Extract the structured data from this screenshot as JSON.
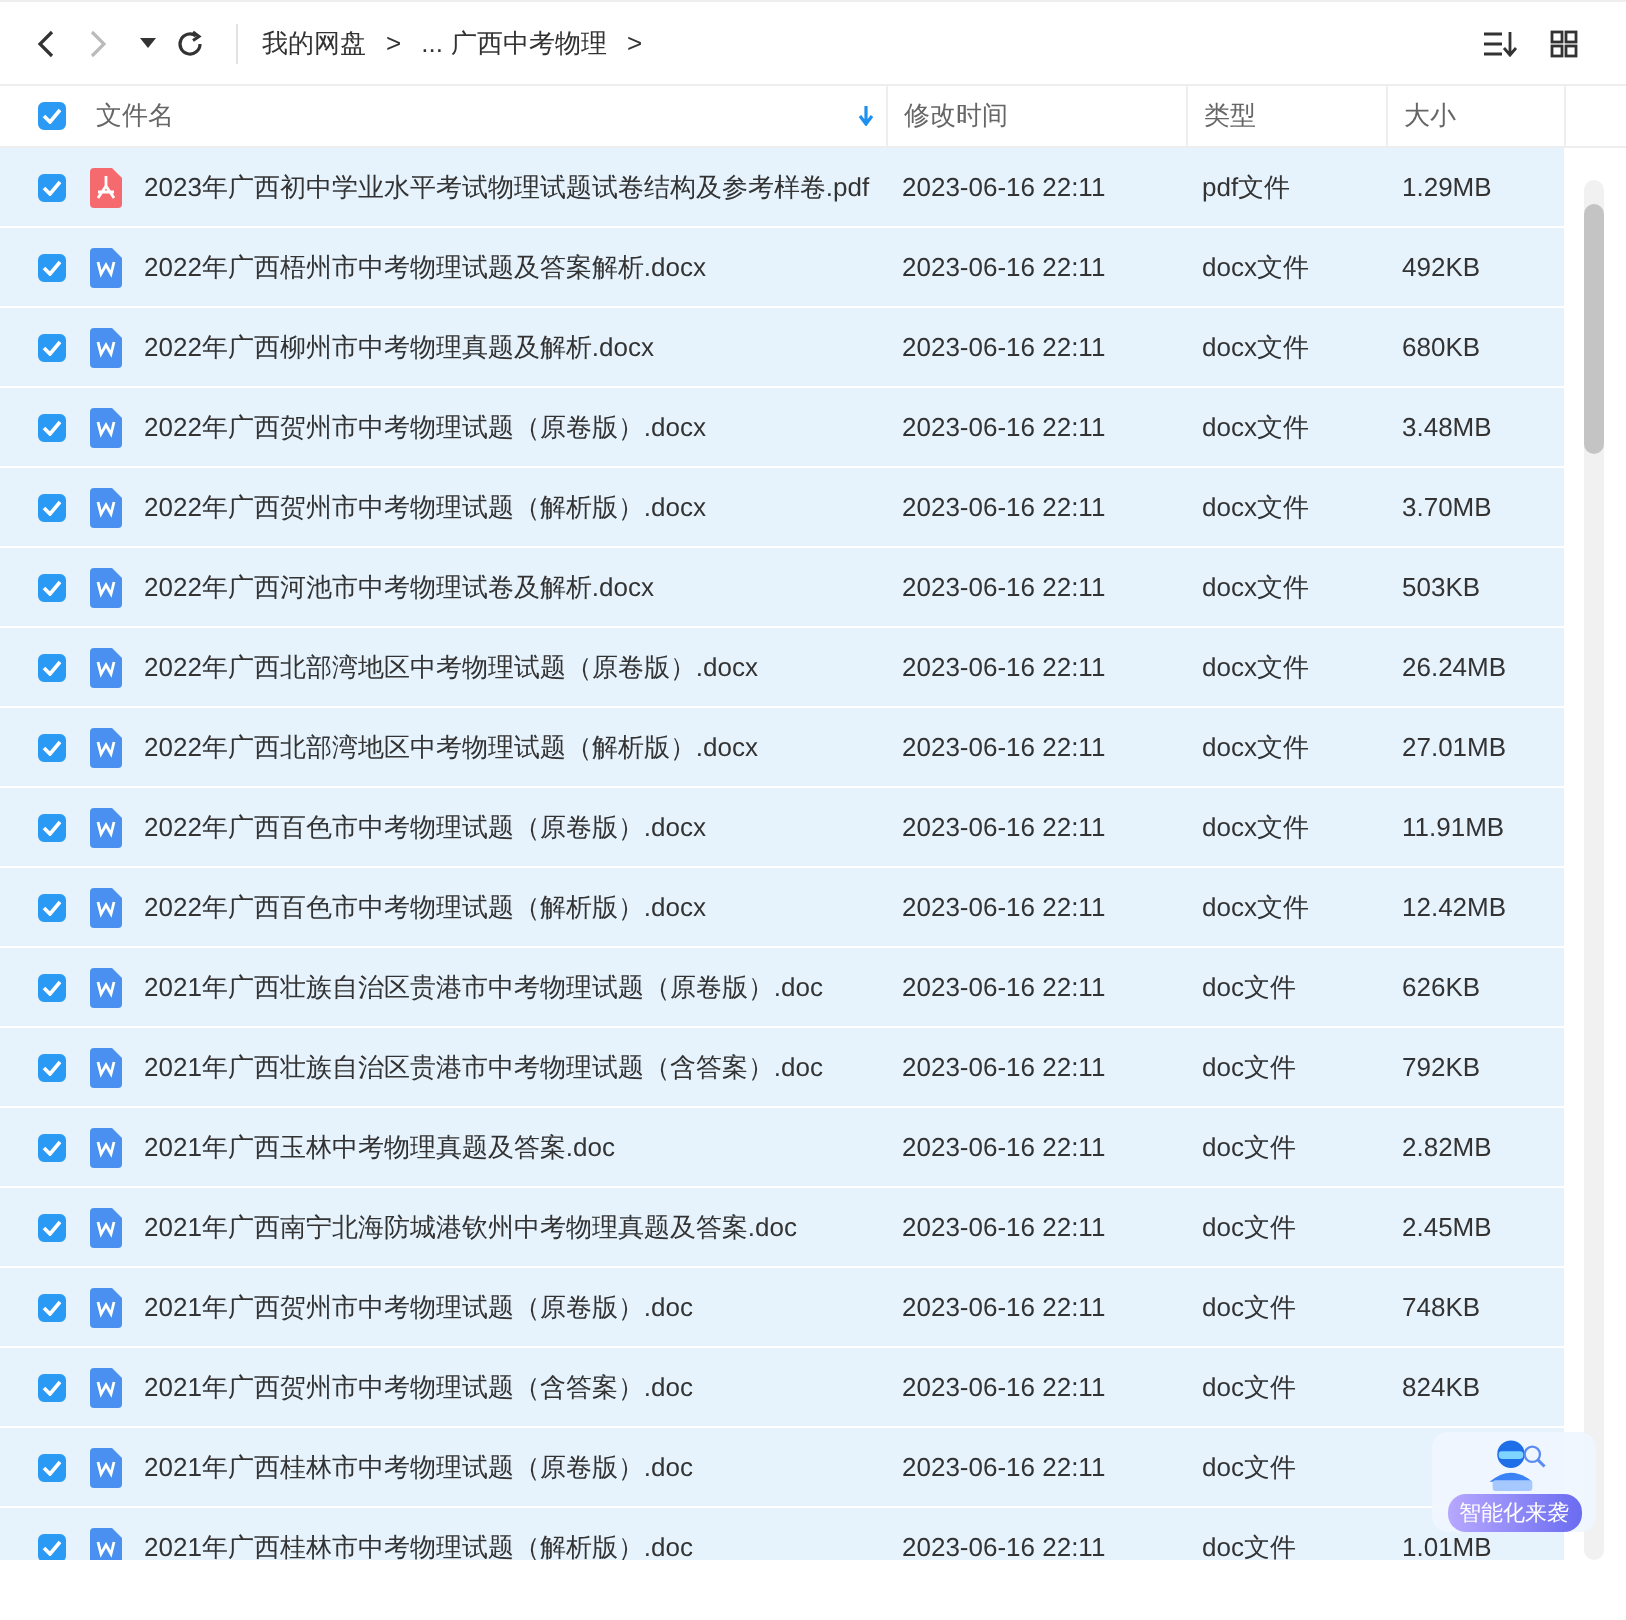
{
  "toolbar": {
    "back_disabled": false,
    "forward_disabled": true,
    "breadcrumb": [
      {
        "label": "我的网盘"
      },
      {
        "label": "..."
      },
      {
        "label": "广西中考物理"
      }
    ],
    "separator": ">"
  },
  "header": {
    "select_all_checked": true,
    "columns": [
      {
        "label": "文件名",
        "sorted": true
      },
      {
        "label": "修改时间",
        "sorted": false
      },
      {
        "label": "类型",
        "sorted": false
      },
      {
        "label": "大小",
        "sorted": false
      }
    ]
  },
  "rows": [
    {
      "kind": "pdf",
      "name": "2023年广西初中学业水平考试物理试题试卷结构及参考样卷.pdf",
      "modified": "2023-06-16 22:11",
      "type": "pdf文件",
      "size": "1.29MB",
      "selected": true
    },
    {
      "kind": "word",
      "name": "2022年广西梧州市中考物理试题及答案解析.docx",
      "modified": "2023-06-16 22:11",
      "type": "docx文件",
      "size": "492KB",
      "selected": true
    },
    {
      "kind": "word",
      "name": "2022年广西柳州市中考物理真题及解析.docx",
      "modified": "2023-06-16 22:11",
      "type": "docx文件",
      "size": "680KB",
      "selected": true
    },
    {
      "kind": "word",
      "name": "2022年广西贺州市中考物理试题（原卷版）.docx",
      "modified": "2023-06-16 22:11",
      "type": "docx文件",
      "size": "3.48MB",
      "selected": true
    },
    {
      "kind": "word",
      "name": "2022年广西贺州市中考物理试题（解析版）.docx",
      "modified": "2023-06-16 22:11",
      "type": "docx文件",
      "size": "3.70MB",
      "selected": true
    },
    {
      "kind": "word",
      "name": "2022年广西河池市中考物理试卷及解析.docx",
      "modified": "2023-06-16 22:11",
      "type": "docx文件",
      "size": "503KB",
      "selected": true
    },
    {
      "kind": "word",
      "name": "2022年广西北部湾地区中考物理试题（原卷版）.docx",
      "modified": "2023-06-16 22:11",
      "type": "docx文件",
      "size": "26.24MB",
      "selected": true
    },
    {
      "kind": "word",
      "name": "2022年广西北部湾地区中考物理试题（解析版）.docx",
      "modified": "2023-06-16 22:11",
      "type": "docx文件",
      "size": "27.01MB",
      "selected": true
    },
    {
      "kind": "word",
      "name": "2022年广西百色市中考物理试题（原卷版）.docx",
      "modified": "2023-06-16 22:11",
      "type": "docx文件",
      "size": "11.91MB",
      "selected": true
    },
    {
      "kind": "word",
      "name": "2022年广西百色市中考物理试题（解析版）.docx",
      "modified": "2023-06-16 22:11",
      "type": "docx文件",
      "size": "12.42MB",
      "selected": true
    },
    {
      "kind": "word",
      "name": "2021年广西壮族自治区贵港市中考物理试题（原卷版）.doc",
      "modified": "2023-06-16 22:11",
      "type": "doc文件",
      "size": "626KB",
      "selected": true
    },
    {
      "kind": "word",
      "name": "2021年广西壮族自治区贵港市中考物理试题（含答案）.doc",
      "modified": "2023-06-16 22:11",
      "type": "doc文件",
      "size": "792KB",
      "selected": true
    },
    {
      "kind": "word",
      "name": "2021年广西玉林中考物理真题及答案.doc",
      "modified": "2023-06-16 22:11",
      "type": "doc文件",
      "size": "2.82MB",
      "selected": true
    },
    {
      "kind": "word",
      "name": "2021年广西南宁北海防城港钦州中考物理真题及答案.doc",
      "modified": "2023-06-16 22:11",
      "type": "doc文件",
      "size": "2.45MB",
      "selected": true
    },
    {
      "kind": "word",
      "name": "2021年广西贺州市中考物理试题（原卷版）.doc",
      "modified": "2023-06-16 22:11",
      "type": "doc文件",
      "size": "748KB",
      "selected": true
    },
    {
      "kind": "word",
      "name": "2021年广西贺州市中考物理试题（含答案）.doc",
      "modified": "2023-06-16 22:11",
      "type": "doc文件",
      "size": "824KB",
      "selected": true
    },
    {
      "kind": "word",
      "name": "2021年广西桂林市中考物理试题（原卷版）.doc",
      "modified": "2023-06-16 22:11",
      "type": "doc文件",
      "selected": true
    },
    {
      "kind": "word",
      "name": "2021年广西桂林市中考物理试题（解析版）.doc",
      "modified": "2023-06-16 22:11",
      "type": "doc文件",
      "size": "1.01MB",
      "selected": true
    }
  ],
  "assistant_widget": {
    "label": "智能化来袭"
  }
}
